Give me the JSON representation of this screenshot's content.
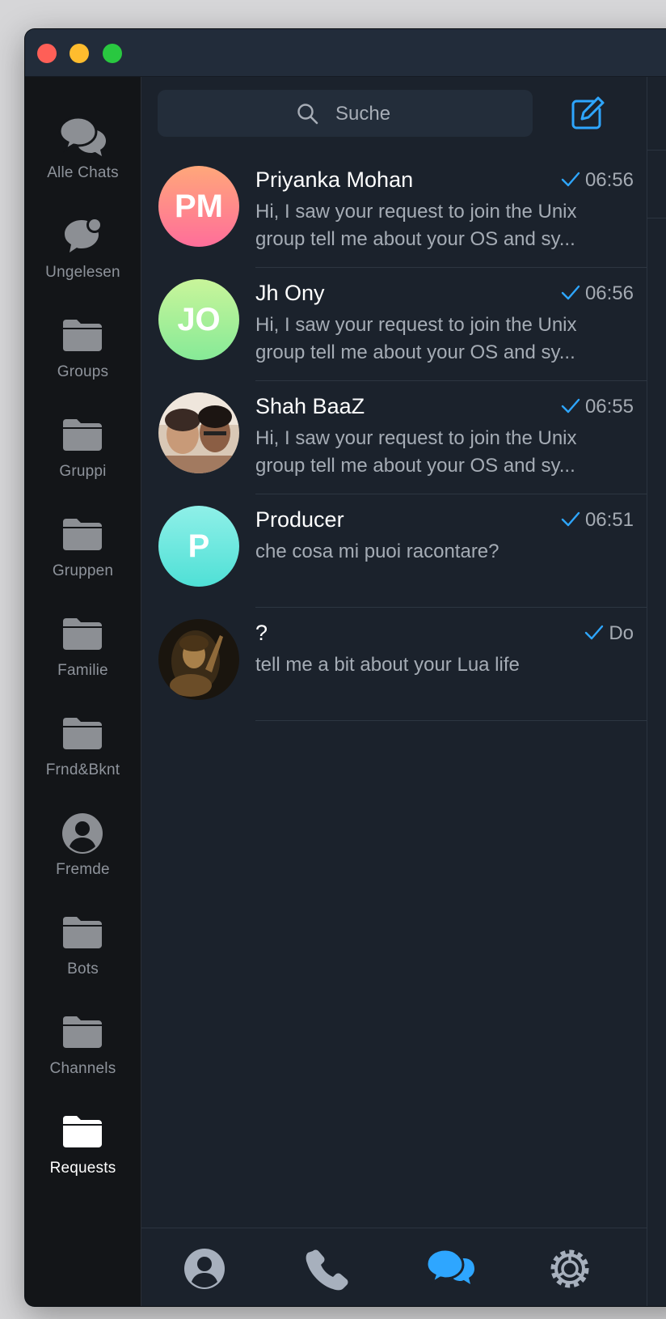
{
  "window": {
    "traffic_lights": {
      "close": "#fe5f57",
      "minimize": "#febc2e",
      "zoom": "#29c840"
    }
  },
  "sidebar": {
    "folders": [
      {
        "label": "Alle Chats",
        "icon": "chats-bubbles-icon"
      },
      {
        "label": "Ungelesen",
        "icon": "unread-bubble-icon"
      },
      {
        "label": "Groups",
        "icon": "folder-icon"
      },
      {
        "label": "Gruppi",
        "icon": "folder-icon"
      },
      {
        "label": "Gruppen",
        "icon": "folder-icon"
      },
      {
        "label": "Familie",
        "icon": "folder-icon"
      },
      {
        "label": "Frnd&Bknt",
        "icon": "folder-icon"
      },
      {
        "label": "Fremde",
        "icon": "person-circle-icon"
      },
      {
        "label": "Bots",
        "icon": "folder-icon"
      },
      {
        "label": "Channels",
        "icon": "folder-icon"
      },
      {
        "label": "Requests",
        "icon": "folder-icon",
        "active": true
      }
    ]
  },
  "search": {
    "placeholder": "Suche"
  },
  "chats": [
    {
      "name": "Priyanka Mohan",
      "initials": "PM",
      "avatar_colors": [
        "#ffa77a",
        "#ff6e9a"
      ],
      "time": "06:56",
      "read": true,
      "preview_line1": "Hi, I saw your request to join the Unix",
      "preview_line2": "group  tell me about your OS and sy..."
    },
    {
      "name": "Jh Ony",
      "initials": "JO",
      "avatar_colors": [
        "#c9f59a",
        "#86ea97"
      ],
      "time": "06:56",
      "read": true,
      "preview_line1": "Hi, I saw your request to join the Unix",
      "preview_line2": "group  tell me about your OS and sy..."
    },
    {
      "name": "Shah BaaZ",
      "initials": "",
      "avatar_colors": [
        "#e8dccb",
        "#8b6048"
      ],
      "time": "06:55",
      "read": true,
      "preview_line1": "Hi, I saw your request to join the Unix",
      "preview_line2": "group  tell me about your OS and sy..."
    },
    {
      "name": "Producer",
      "initials": "P",
      "avatar_colors": [
        "#8ff0e8",
        "#4fe0d6"
      ],
      "time": "06:51",
      "read": true,
      "preview_line1": "che cosa mi puoi racontare?",
      "preview_line2": ""
    },
    {
      "name": "?",
      "initials": "",
      "avatar_colors": [
        "#7a5a34",
        "#1e1a12"
      ],
      "time": "Do",
      "read": true,
      "preview_line1": "tell me a bit about your Lua life",
      "preview_line2": ""
    }
  ],
  "tabbar": {
    "tabs": [
      {
        "icon": "contacts-icon"
      },
      {
        "icon": "phone-icon"
      },
      {
        "icon": "chats-icon",
        "active": true
      },
      {
        "icon": "settings-gear-icon"
      }
    ]
  },
  "colors": {
    "accent": "#2ea6ff",
    "background": "#1b222c",
    "sidebar": "#131518"
  }
}
